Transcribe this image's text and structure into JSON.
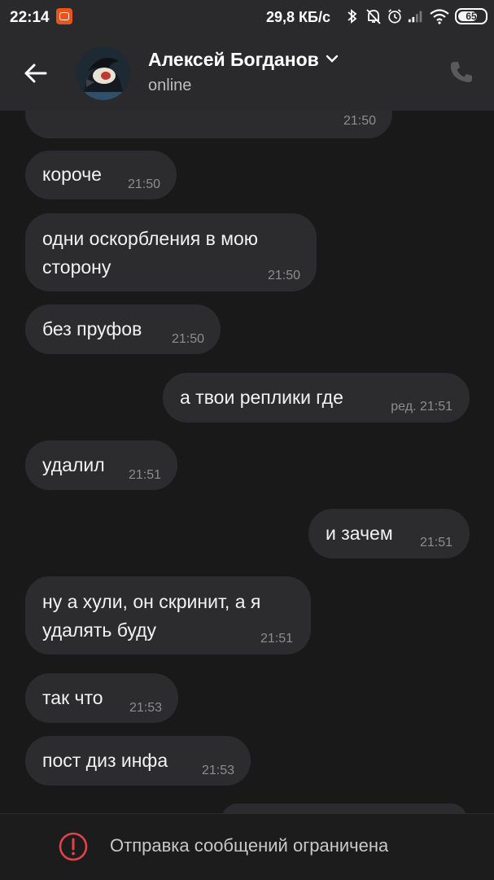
{
  "status_bar": {
    "time": "22:14",
    "speed": "29,8 КБ/с",
    "battery": "65",
    "icons": [
      "app-notification-icon",
      "bluetooth-icon",
      "mute-icon",
      "alarm-icon",
      "signal-icon",
      "wifi-icon",
      "battery-icon"
    ]
  },
  "header": {
    "contact_name": "Алексей Богданов",
    "presence": "online",
    "icons": [
      "back-arrow-icon",
      "chevron-down-icon",
      "phone-icon"
    ]
  },
  "messages": [
    {
      "text": "",
      "time": "21:50",
      "side": "in"
    },
    {
      "text": "короче",
      "time": "21:50",
      "side": "in"
    },
    {
      "text": "одни оскорбления в мою\nсторону",
      "time": "21:50",
      "side": "in"
    },
    {
      "text": "без пруфов",
      "time": "21:50",
      "side": "in"
    },
    {
      "text": "а твои реплики где",
      "time": "ред. 21:51",
      "side": "out"
    },
    {
      "text": "удалил",
      "time": "21:51",
      "side": "in"
    },
    {
      "text": "и зачем",
      "time": "21:51",
      "side": "out"
    },
    {
      "text": "ну а хули, он скринит, а я\nудалять буду",
      "time": "21:51",
      "side": "in"
    },
    {
      "text": "так что",
      "time": "21:53",
      "side": "in"
    },
    {
      "text": "пост диз инфа",
      "time": "21:53",
      "side": "in"
    }
  ],
  "footer": {
    "restriction_text": "Отправка сообщений ограничена",
    "icon": "exclamation-circle-icon"
  },
  "colors": {
    "background": "#19191a",
    "bubble": "#2c2c2e",
    "bar": "#2a2a2c",
    "warning": "#e0434a"
  }
}
